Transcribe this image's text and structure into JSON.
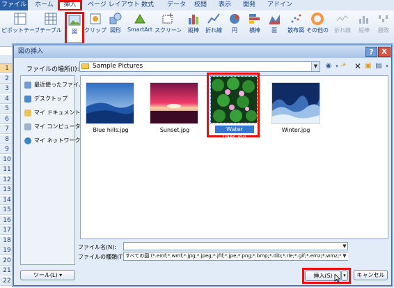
{
  "ribbon": {
    "tabs": [
      "ファイル",
      "ホーム",
      "挿入",
      "ページ レイアウト",
      "数式",
      "データ",
      "校閲",
      "表示",
      "開発",
      "アドイン"
    ],
    "buttons": [
      "ピボットテーブル",
      "テーブル",
      "図",
      "クリップ アート",
      "図形",
      "SmartArt",
      "スクリーン ショット",
      "縦棒",
      "折れ線",
      "円",
      "横棒",
      "面",
      "散布図",
      "その他の グラフ",
      "折れ線",
      "縦棒",
      "勝敗"
    ]
  },
  "sheet": {
    "rows": [
      "1",
      "2",
      "3",
      "4",
      "5",
      "6",
      "7",
      "8",
      "9",
      "10",
      "11",
      "12",
      "13",
      "14",
      "15",
      "16",
      "17",
      "18",
      "19",
      "20",
      "21",
      "22"
    ]
  },
  "dialog": {
    "title": "図の挿入",
    "help": "?",
    "close": "X",
    "location_label": "ファイルの場所(I):",
    "location_value": "Sample Pictures",
    "places": [
      "最近使ったファイル",
      "デスクトップ",
      "マイ ドキュメント",
      "マイ コンピュータ",
      "マイ ネットワーク"
    ],
    "files": [
      {
        "name": "Blue hills.jpg"
      },
      {
        "name": "Sunset.jpg"
      },
      {
        "name": "Water lilies.jpg"
      },
      {
        "name": "Winter.jpg"
      }
    ],
    "file_name_label": "ファイル名(N):",
    "file_name_value": "",
    "file_type_label": "ファイルの種類(T):",
    "file_type_value": "すべての図 (*.emf;*.wmf;*.jpg;*.jpeg;*.jfif;*.jpe;*.png;*.bmp;*.dib;*.rle;*.gif;*.emz;*.wmz;*.pc",
    "tools_button": "ツール(L)",
    "insert_button": "挿入(S)",
    "cancel_button": "キャンセル"
  },
  "colors": {
    "highlight": "#e8100d",
    "selection": "#3875d7",
    "file_tab": "#2a5ea8"
  }
}
